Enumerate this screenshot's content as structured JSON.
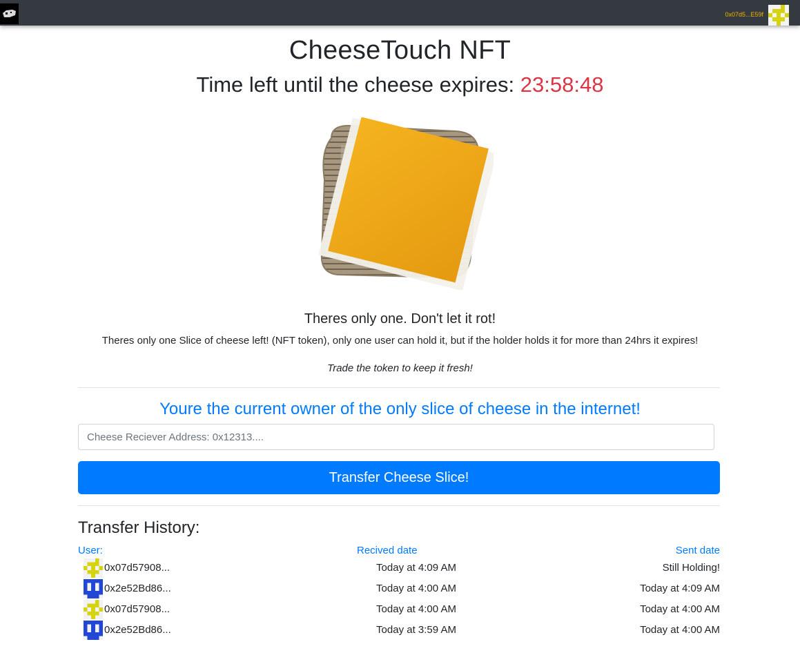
{
  "navbar": {
    "logo_icon": "cheese-logo-icon",
    "account_address": "0x07d5...E59f",
    "account_avatar_icon": "yellow-pixel-identicon"
  },
  "header": {
    "title": "CheeseTouch NFT",
    "countdown_label": "Time left until the cheese expires:",
    "countdown_value": "23:58:48"
  },
  "hero_image": "cheese-toast-image",
  "info": {
    "tagline": "Theres only one. Don't let it rot!",
    "description": "Theres only one Slice of cheese left! (NFT token), only one user can hold it, but if the holder holds it for more than 24hrs it expires!",
    "subnote": "Trade the token to keep it fresh!"
  },
  "transfer": {
    "owner_message": "Youre the current owner of the only slice of cheese in the internet!",
    "input_placeholder": "Cheese Reciever Address: 0x12313....",
    "button_label": "Transfer Cheese Slice!"
  },
  "history": {
    "title": "Transfer History:",
    "columns": {
      "user": "User:",
      "received": "Recived date",
      "sent": "Sent date"
    },
    "rows": [
      {
        "user": "0x07d57908...",
        "received": "Today at 4:09 AM",
        "sent": "Still Holding!",
        "avatar": "yellow-pixel-identicon"
      },
      {
        "user": "0x2e52Bd86...",
        "received": "Today at 4:00 AM",
        "sent": "Today at 4:09 AM",
        "avatar": "blue-pixel-identicon"
      },
      {
        "user": "0x07d57908...",
        "received": "Today at 4:00 AM",
        "sent": "Today at 4:00 AM",
        "avatar": "yellow-pixel-identicon"
      },
      {
        "user": "0x2e52Bd86...",
        "received": "Today at 3:59 AM",
        "sent": "Today at 4:00 AM",
        "avatar": "blue-pixel-identicon"
      }
    ]
  },
  "colors": {
    "navbar_bg": "#343a40",
    "accent_blue": "#007bff",
    "countdown_red": "#dc3545",
    "address_orange": "#f5b400",
    "identicon_yellow": "#d6d40f",
    "identicon_blue": "#2147d6"
  }
}
